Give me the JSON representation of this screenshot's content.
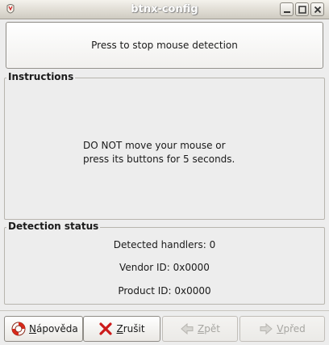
{
  "window": {
    "title": "btnx-config",
    "controls": {
      "minimize": "minimize-icon",
      "maximize": "maximize-icon",
      "close": "close-icon"
    }
  },
  "detect_button": {
    "label": "Press to stop mouse detection"
  },
  "instructions": {
    "heading": "Instructions",
    "line1": "DO NOT move your mouse or",
    "line2": "press its buttons for 5 seconds."
  },
  "detection_status": {
    "heading": "Detection status",
    "handlers": "Detected handlers: 0",
    "vendor": "Vendor ID: 0x0000",
    "product": "Product ID: 0x0000"
  },
  "buttons": {
    "help": {
      "mnemonic": "N",
      "rest": "ápověda",
      "icon": "lifebuoy-icon",
      "enabled": true
    },
    "cancel": {
      "mnemonic": "Z",
      "rest": "rušit",
      "icon": "red-x-icon",
      "enabled": true
    },
    "back": {
      "mnemonic": "Z",
      "rest": "pět",
      "icon": "back-arrow-icon",
      "enabled": false
    },
    "next": {
      "mnemonic": "V",
      "rest": "před",
      "icon": "forward-arrow-icon",
      "enabled": false
    }
  },
  "colors": {
    "accent_red": "#cc1a1a",
    "disabled_text": "#a7a6a2",
    "background": "#ededed"
  }
}
